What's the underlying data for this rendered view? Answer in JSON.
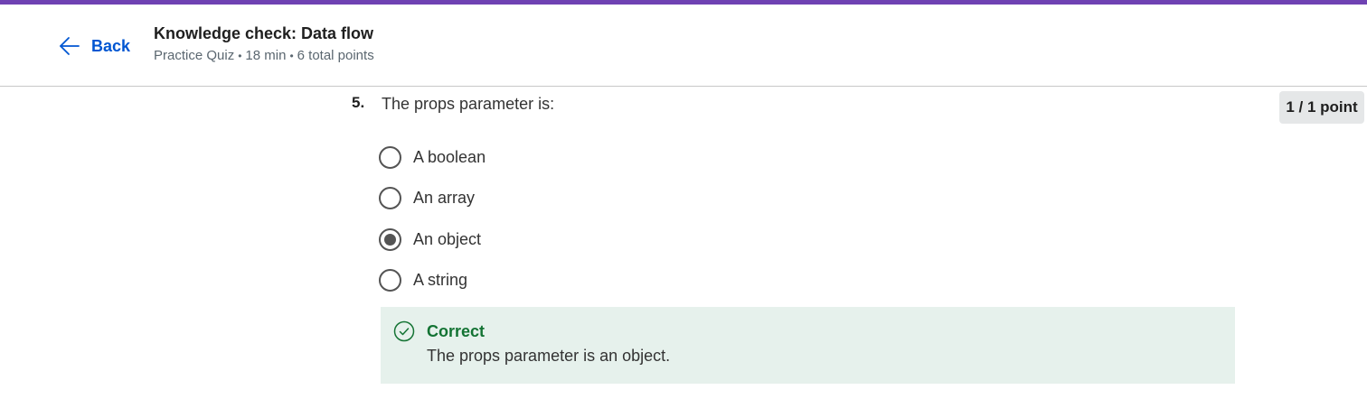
{
  "header": {
    "back_label": "Back",
    "title": "Knowledge check: Data flow",
    "meta": {
      "type": "Practice Quiz",
      "duration": "18 min",
      "points": "6 total points"
    }
  },
  "question": {
    "number": "5.",
    "text": "The props parameter is:",
    "score": "1 / 1 point",
    "options": [
      {
        "label": "A boolean",
        "selected": false
      },
      {
        "label": "An array",
        "selected": false
      },
      {
        "label": "An object",
        "selected": true
      },
      {
        "label": "A string",
        "selected": false
      }
    ]
  },
  "feedback": {
    "status": "Correct",
    "explanation": "The props parameter is an object."
  },
  "colors": {
    "accent_bar": "#6f42b3",
    "link": "#0056d2",
    "correct": "#137333",
    "feedback_bg": "#e6f1ec"
  }
}
